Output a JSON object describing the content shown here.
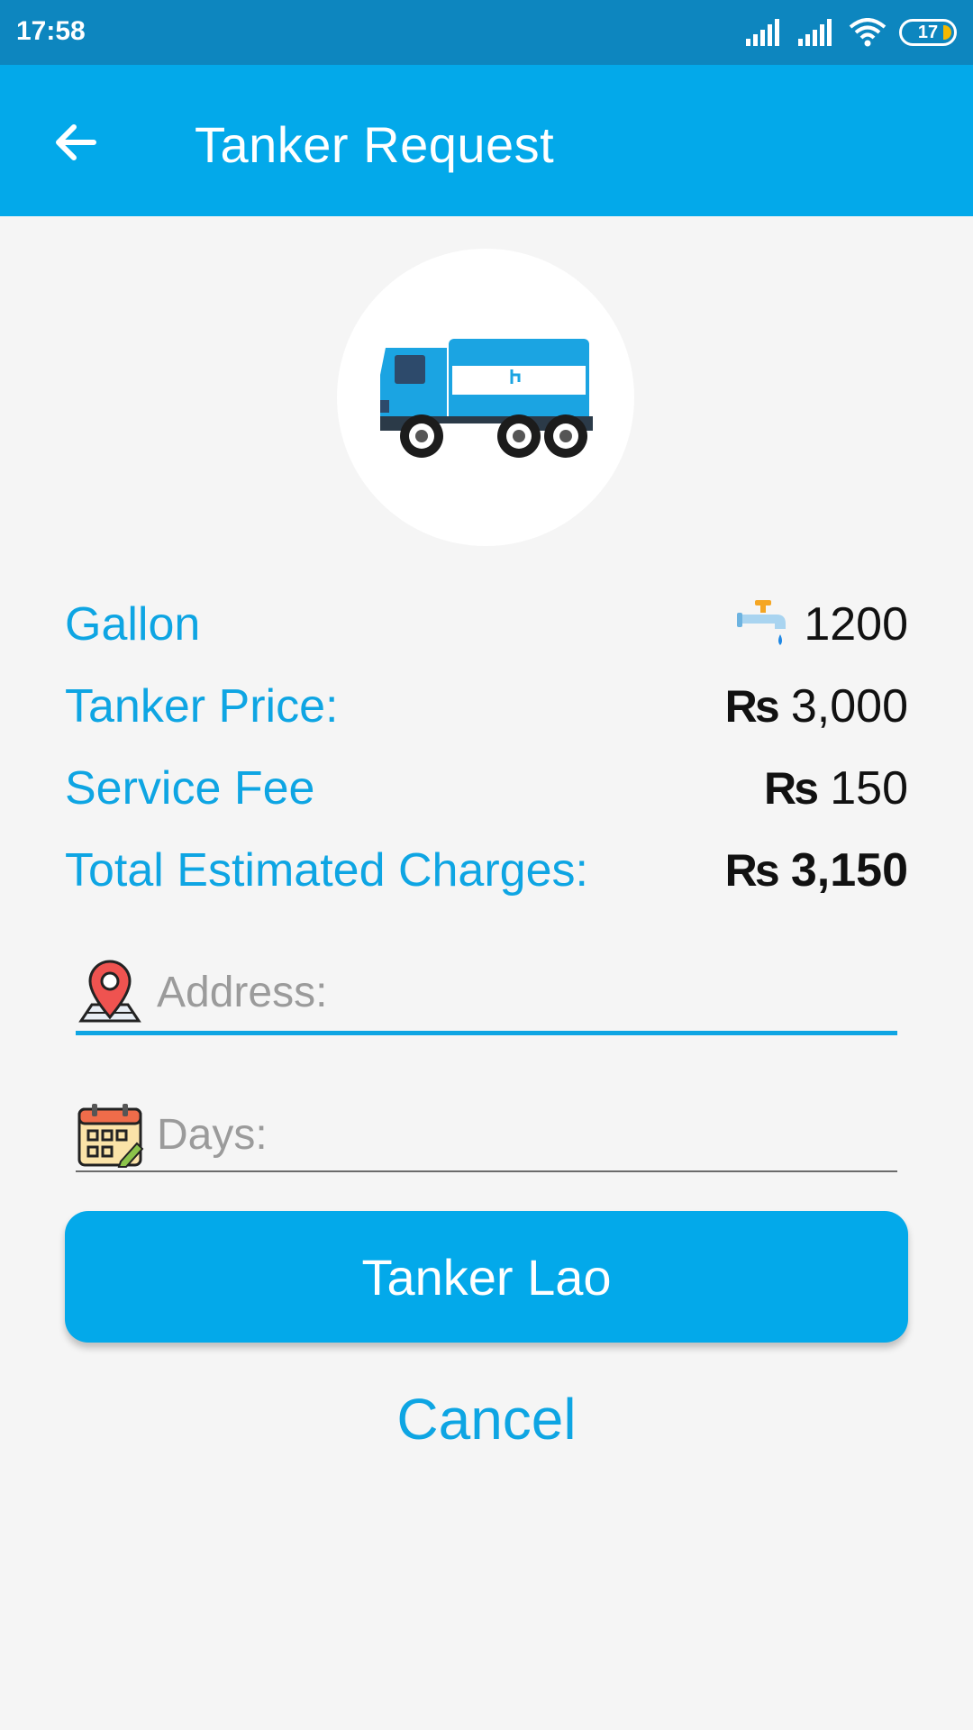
{
  "status_bar": {
    "time": "17:58",
    "battery": "17",
    "icons": [
      "signal-icon",
      "signal-icon",
      "wifi-icon",
      "battery-icon"
    ]
  },
  "app_bar": {
    "title": "Tanker Request",
    "back_icon": "arrow-left-icon"
  },
  "details": {
    "gallon_label": "Gallon",
    "gallon_value": "1200",
    "tanker_price_label": "Tanker Price:",
    "tanker_price_currency": "₨",
    "tanker_price_value": "3,000",
    "service_fee_label": "Service Fee",
    "service_fee_currency": "₨",
    "service_fee_value": "150",
    "total_label": "Total Estimated Charges:",
    "total_currency": "₨",
    "total_value": "3,150"
  },
  "form": {
    "address_placeholder": "Address:",
    "address_value": "",
    "days_placeholder": "Days:",
    "days_value": ""
  },
  "actions": {
    "submit_label": "Tanker Lao",
    "cancel_label": "Cancel"
  },
  "colors": {
    "status_bar": "#0d86bf",
    "app_bar": "#03a9ea",
    "accent_text": "#0ea5e3",
    "background": "#f5f5f5"
  }
}
